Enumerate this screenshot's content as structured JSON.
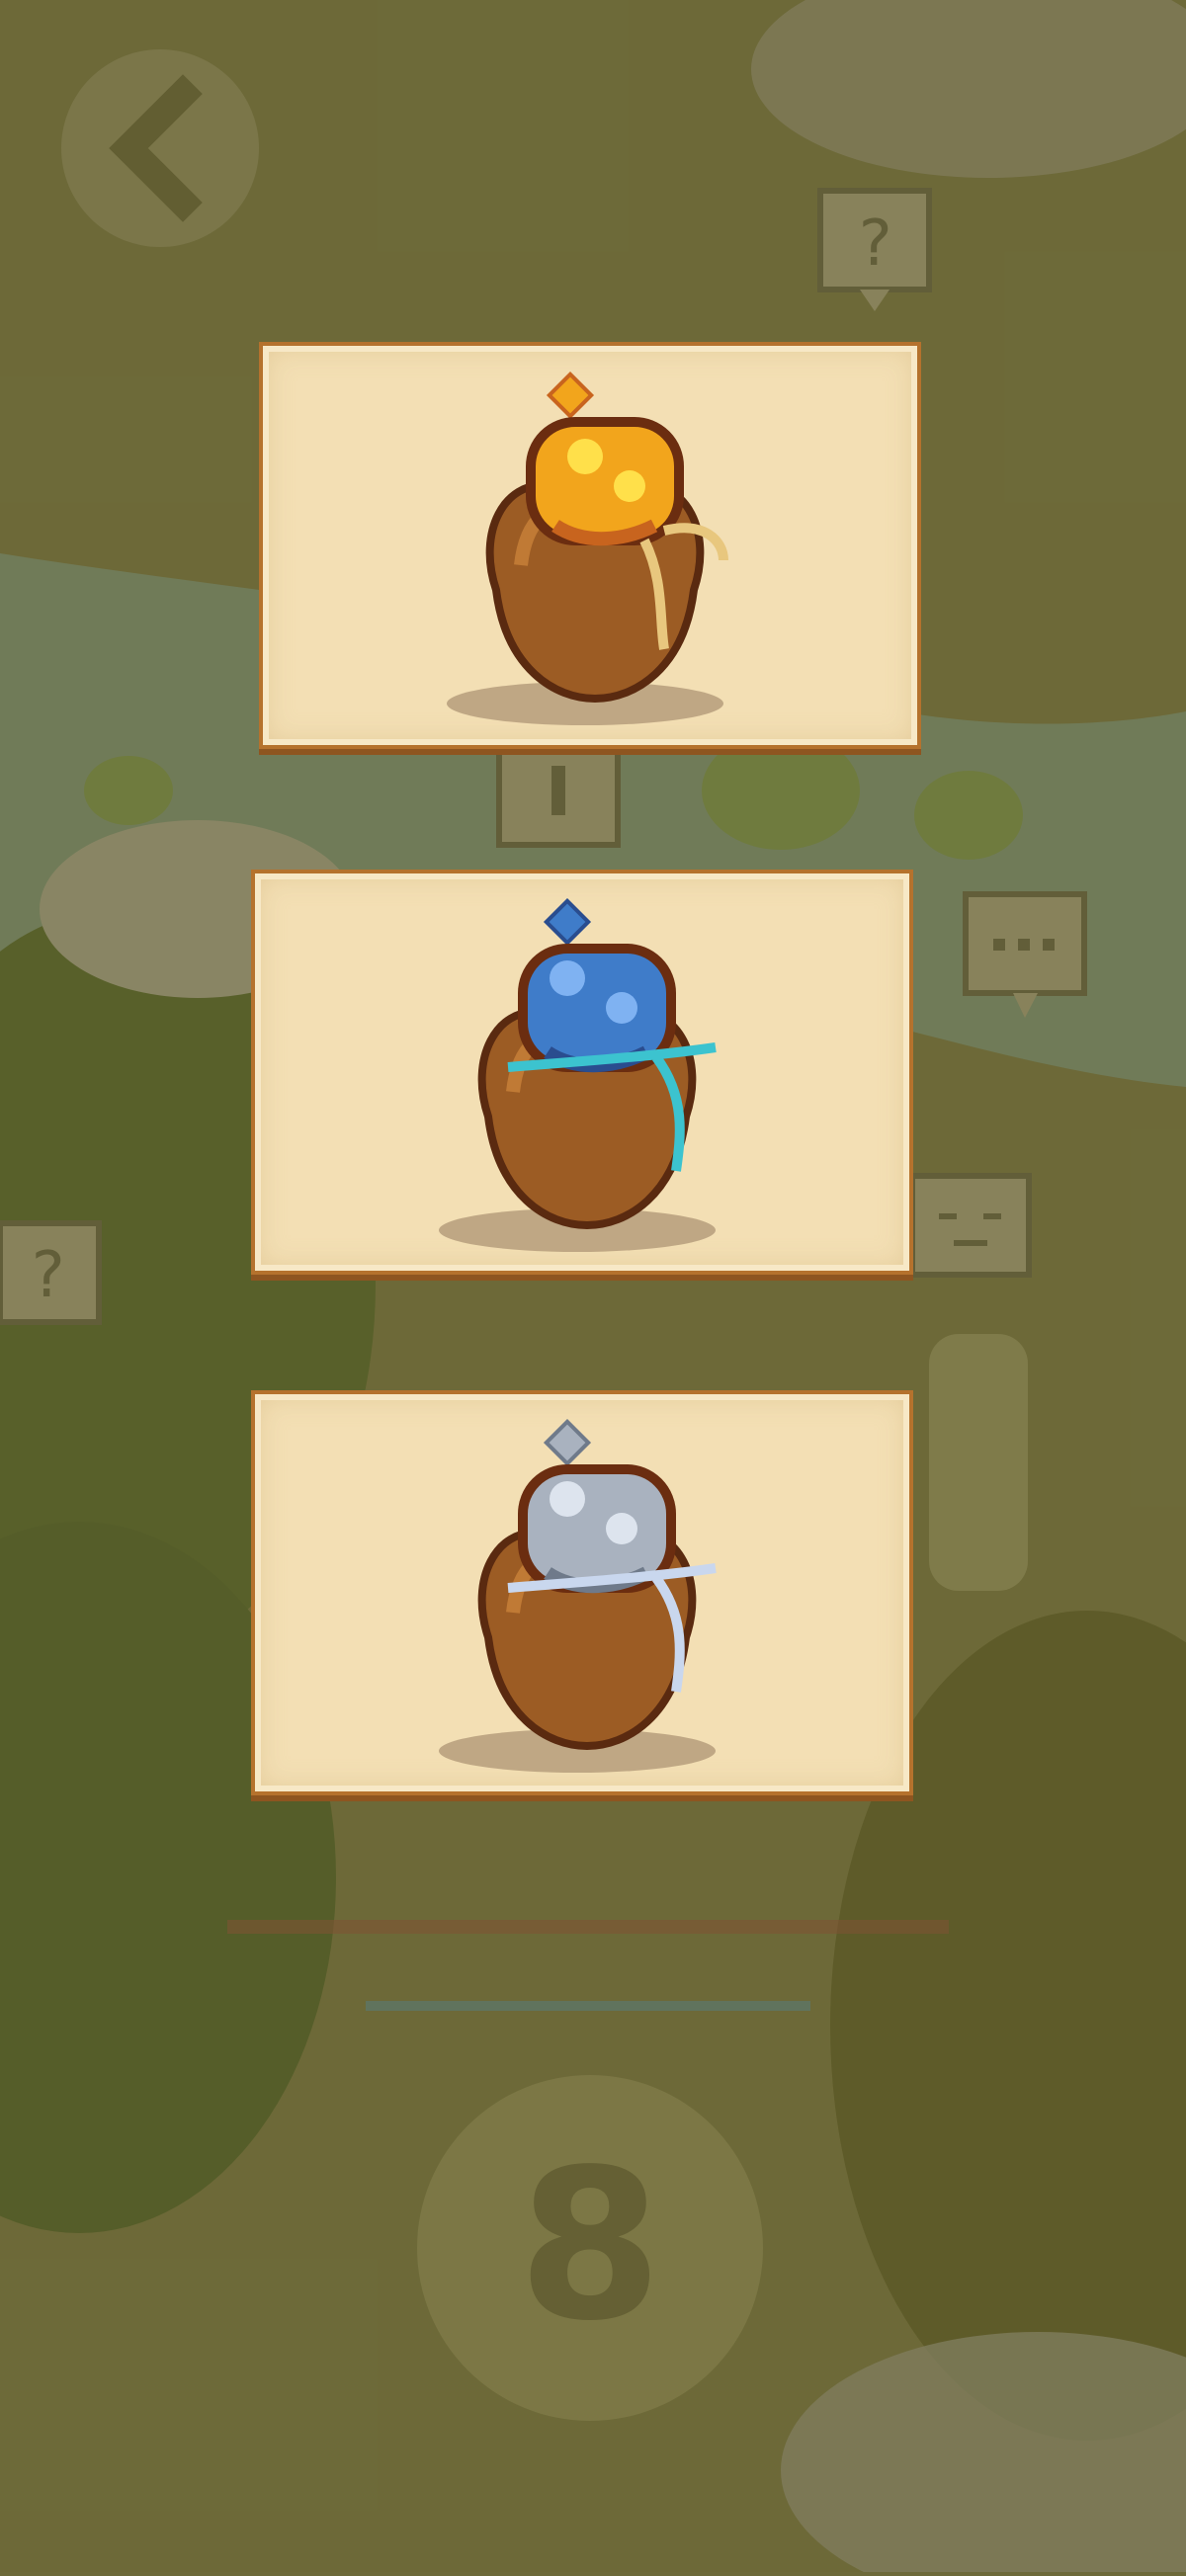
{
  "screen": {
    "name": "pouch-selection",
    "background_tint": "#6e6a3a"
  },
  "cards": [
    {
      "id": "pouch-gold",
      "icon": "gold-pouch-icon",
      "gem_color": "#f2a51c",
      "gem_light": "#ffe04a",
      "gem_dark": "#c8641e",
      "string_color": "#e8c77e"
    },
    {
      "id": "pouch-blue",
      "icon": "blue-pouch-icon",
      "gem_color": "#3f7cc9",
      "gem_light": "#7fb2f2",
      "gem_dark": "#2a4d8f",
      "string_color": "#3cc3cf"
    },
    {
      "id": "pouch-silver",
      "icon": "silver-pouch-icon",
      "gem_color": "#a9b2bf",
      "gem_light": "#dde4ee",
      "gem_dark": "#6f7a8a",
      "string_color": "#c9d7ee"
    }
  ],
  "background_icons": {
    "back": "back-arrow-icon",
    "help_top": "question-mark-icon",
    "help_left": "question-mark-icon",
    "chat": "speech-bubble-icon",
    "face": "face-bubble-icon",
    "alert": "exclamation-bubble-icon",
    "level": "8"
  }
}
